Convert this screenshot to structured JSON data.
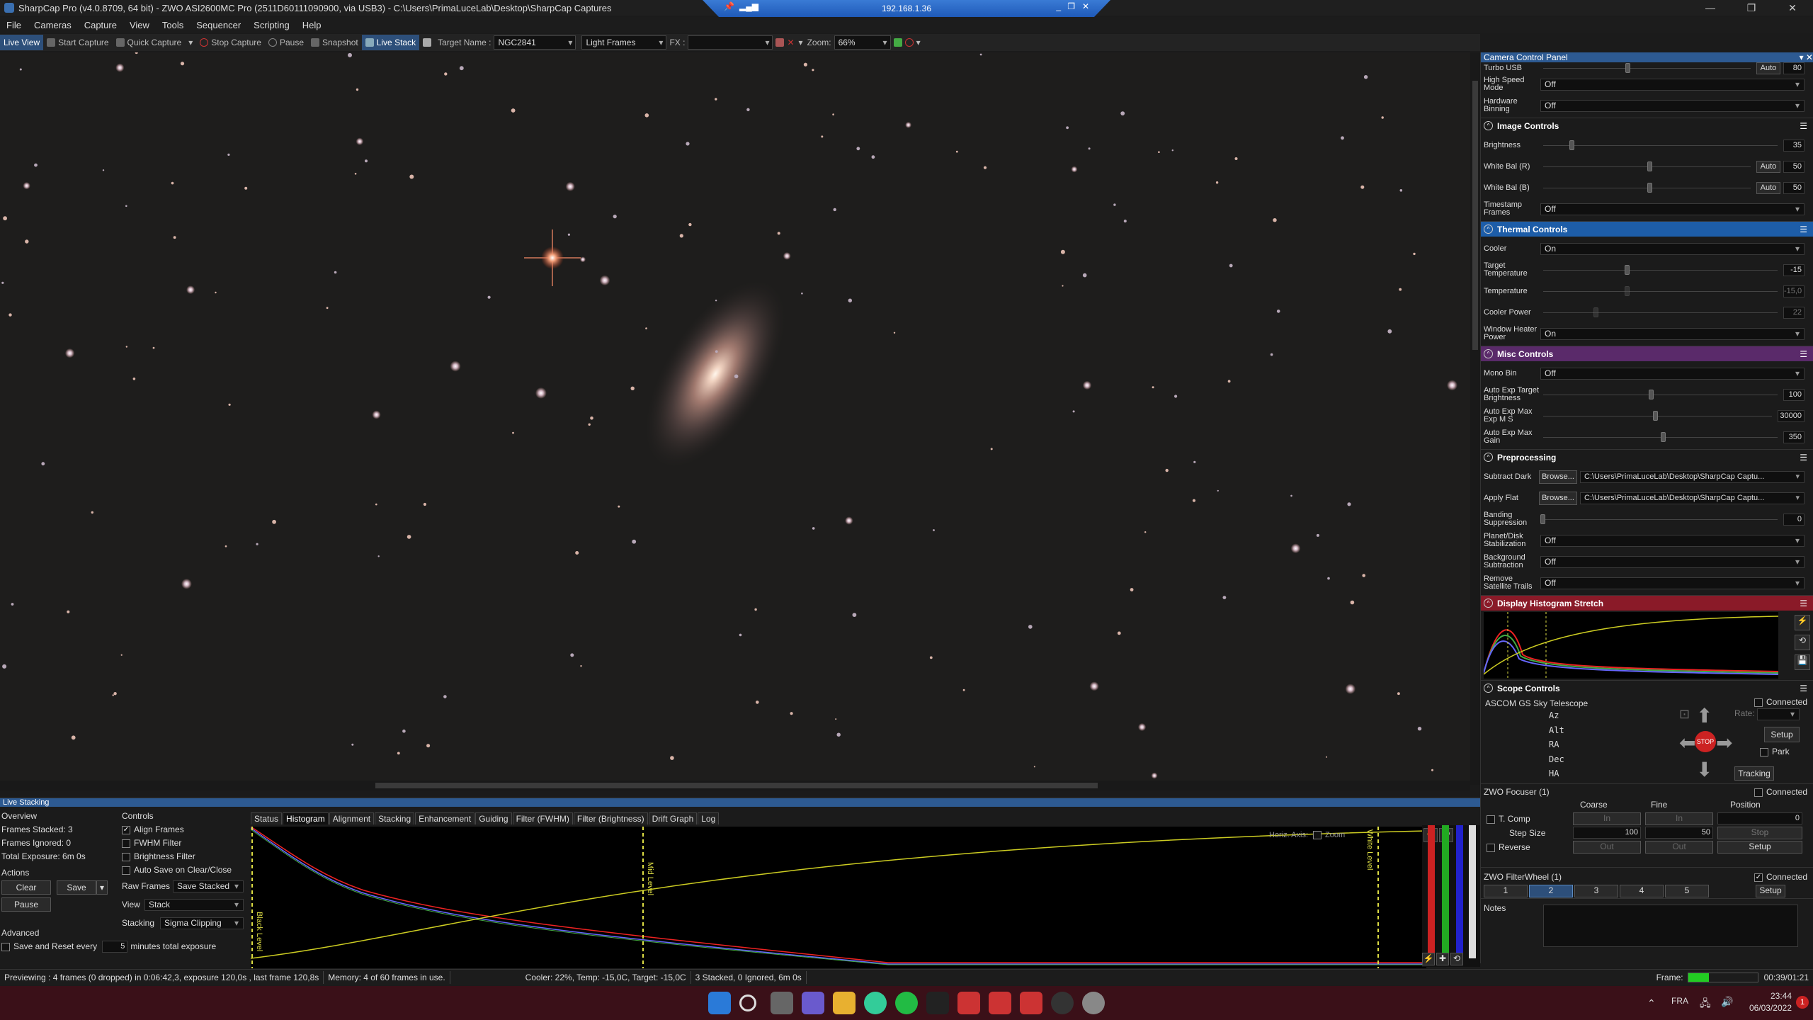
{
  "titlebar": {
    "title": "SharpCap Pro (v4.0.8709, 64 bit) - ZWO ASI2600MC Pro (2511D60111090900, via USB3) - C:\\Users\\PrimaLuceLab\\Desktop\\SharpCap Captures",
    "minimize": "—",
    "maximize": "❐",
    "close": "✕"
  },
  "remote": {
    "ip": "192.168.1.36"
  },
  "menu": [
    "File",
    "Cameras",
    "Capture",
    "View",
    "Tools",
    "Sequencer",
    "Scripting",
    "Help"
  ],
  "toolbar": {
    "live_view": "Live View",
    "start_capture": "Start Capture",
    "quick_capture": "Quick Capture",
    "stop_capture": "Stop Capture",
    "pause": "Pause",
    "snapshot": "Snapshot",
    "live_stack": "Live Stack",
    "target_label": "Target Name :",
    "target_value": "NGC2841",
    "frame_type": "Light Frames",
    "fx_label": "FX :",
    "fx_value": "",
    "zoom_label": "Zoom:",
    "zoom_value": "66%"
  },
  "panel": {
    "title": "Camera Control Panel",
    "top_rows": [
      {
        "label": "High Speed Mode",
        "value": "Off"
      },
      {
        "label": "Hardware Binning",
        "value": "Off"
      }
    ],
    "turbo": {
      "label": "Turbo USB",
      "auto": "Auto",
      "value": "80"
    },
    "image_controls": {
      "title": "Image Controls",
      "brightness": {
        "label": "Brightness",
        "value": "35"
      },
      "wb_r": {
        "label": "White Bal (R)",
        "auto": "Auto",
        "value": "50"
      },
      "wb_b": {
        "label": "White Bal (B)",
        "auto": "Auto",
        "value": "50"
      },
      "timestamp": {
        "label": "Timestamp Frames",
        "value": "Off"
      }
    },
    "thermal": {
      "title": "Thermal Controls",
      "cooler": {
        "label": "Cooler",
        "value": "On"
      },
      "target_temp": {
        "label": "Target Temperature",
        "value": "-15"
      },
      "temperature": {
        "label": "Temperature",
        "value": "-15,0"
      },
      "cooler_power": {
        "label": "Cooler Power",
        "value": "22"
      },
      "window_heater": {
        "label": "Window Heater Power",
        "value": "On"
      }
    },
    "misc": {
      "title": "Misc Controls",
      "mono_bin": {
        "label": "Mono Bin",
        "value": "Off"
      },
      "ae_target": {
        "label": "Auto Exp Target Brightness",
        "value": "100"
      },
      "ae_max": {
        "label": "Auto Exp Max Exp M S",
        "value": "30000"
      },
      "ae_gain": {
        "label": "Auto Exp Max Gain",
        "value": "350"
      }
    },
    "pre": {
      "title": "Preprocessing",
      "dark": {
        "label": "Subtract Dark",
        "browse": "Browse...",
        "value": "C:\\Users\\PrimaLuceLab\\Desktop\\SharpCap Captu..."
      },
      "flat": {
        "label": "Apply Flat",
        "browse": "Browse...",
        "value": "C:\\Users\\PrimaLuceLab\\Desktop\\SharpCap Captu..."
      },
      "banding": {
        "label": "Banding Suppression",
        "value": "0"
      },
      "planet": {
        "label": "Planet/Disk Stabilization",
        "value": "Off"
      },
      "bg": {
        "label": "Background Subtraction",
        "value": "Off"
      },
      "trails": {
        "label": "Remove Satellite Trails",
        "value": "Off"
      }
    },
    "histo_title": "Display Histogram Stretch",
    "scope": {
      "title": "Scope Controls",
      "connected": "Connected",
      "name": "ASCOM GS Sky Telescope",
      "coords": [
        "Az",
        "Alt",
        "RA",
        "Dec",
        "HA"
      ],
      "rate": "Rate:",
      "setup": "Setup",
      "park": "Park",
      "tracking": "Tracking",
      "stop": "STOP"
    },
    "focuser": {
      "title": "ZWO Focuser (1)",
      "connected": "Connected",
      "coarse": "Coarse",
      "fine": "Fine",
      "position": "Position",
      "tcomp": "T. Comp",
      "in": "In",
      "pos_value": "0",
      "step_label": "Step Size",
      "coarse_step": "100",
      "fine_step": "50",
      "stop": "Stop",
      "reverse": "Reverse",
      "out": "Out",
      "setup": "Setup"
    },
    "wheel": {
      "title": "ZWO FilterWheel (1)",
      "connected": "Connected",
      "slots": [
        "1",
        "2",
        "3",
        "4",
        "5"
      ],
      "setup": "Setup"
    },
    "notes": "Notes"
  },
  "stack": {
    "title": "Live Stacking",
    "overview": "Overview",
    "frames_stacked": "Frames Stacked: 3",
    "frames_ignored": "Frames Ignored: 0",
    "total_exposure": "Total Exposure:  6m 0s",
    "actions": "Actions",
    "clear": "Clear",
    "save": "Save",
    "pause": "Pause",
    "advanced": "Advanced",
    "save_reset": "Save and Reset every",
    "save_reset_value": "5",
    "minutes": "minutes total exposure",
    "controls": "Controls",
    "align": "Align Frames",
    "fwhm": "FWHM Filter",
    "brightness": "Brightness Filter",
    "autosave": "Auto Save on Clear/Close",
    "raw_label": "Raw Frames",
    "raw_value": "Save Stacked",
    "view_label": "View",
    "view_value": "Stack",
    "stacking_label": "Stacking",
    "stacking_value": "Sigma Clipping",
    "tabs": [
      "Status",
      "Histogram",
      "Alignment",
      "Stacking",
      "Enhancement",
      "Guiding",
      "Filter (FWHM)",
      "Filter (Brightness)",
      "Drift Graph",
      "Log"
    ],
    "horiz": "Horiz. Axis:",
    "zoom": "Zoom",
    "black": "Black Level",
    "mid": "Mid Level",
    "white": "White Level"
  },
  "status": {
    "preview": "Previewing : 4 frames (0 dropped) in 0:06:42,3, exposure 120,0s , last frame 120,8s",
    "memory": "Memory: 4 of 60 frames in use.",
    "cooler": "Cooler: 22%, Temp: -15,0C, Target: -15,0C",
    "stack": "3 Stacked, 0 Ignored, 6m 0s",
    "frame_label": "Frame:",
    "time": "00:39/01:21"
  },
  "taskbar": {
    "lang": "FRA",
    "clock": "23:44",
    "date": "06/03/2022",
    "badge": "1"
  },
  "colors": {
    "accent": "#2d5a92",
    "thermal": "#1d5da8",
    "misc": "#5a2a6a",
    "histo": "#8a1a28",
    "taskbar": "#3a1018"
  }
}
